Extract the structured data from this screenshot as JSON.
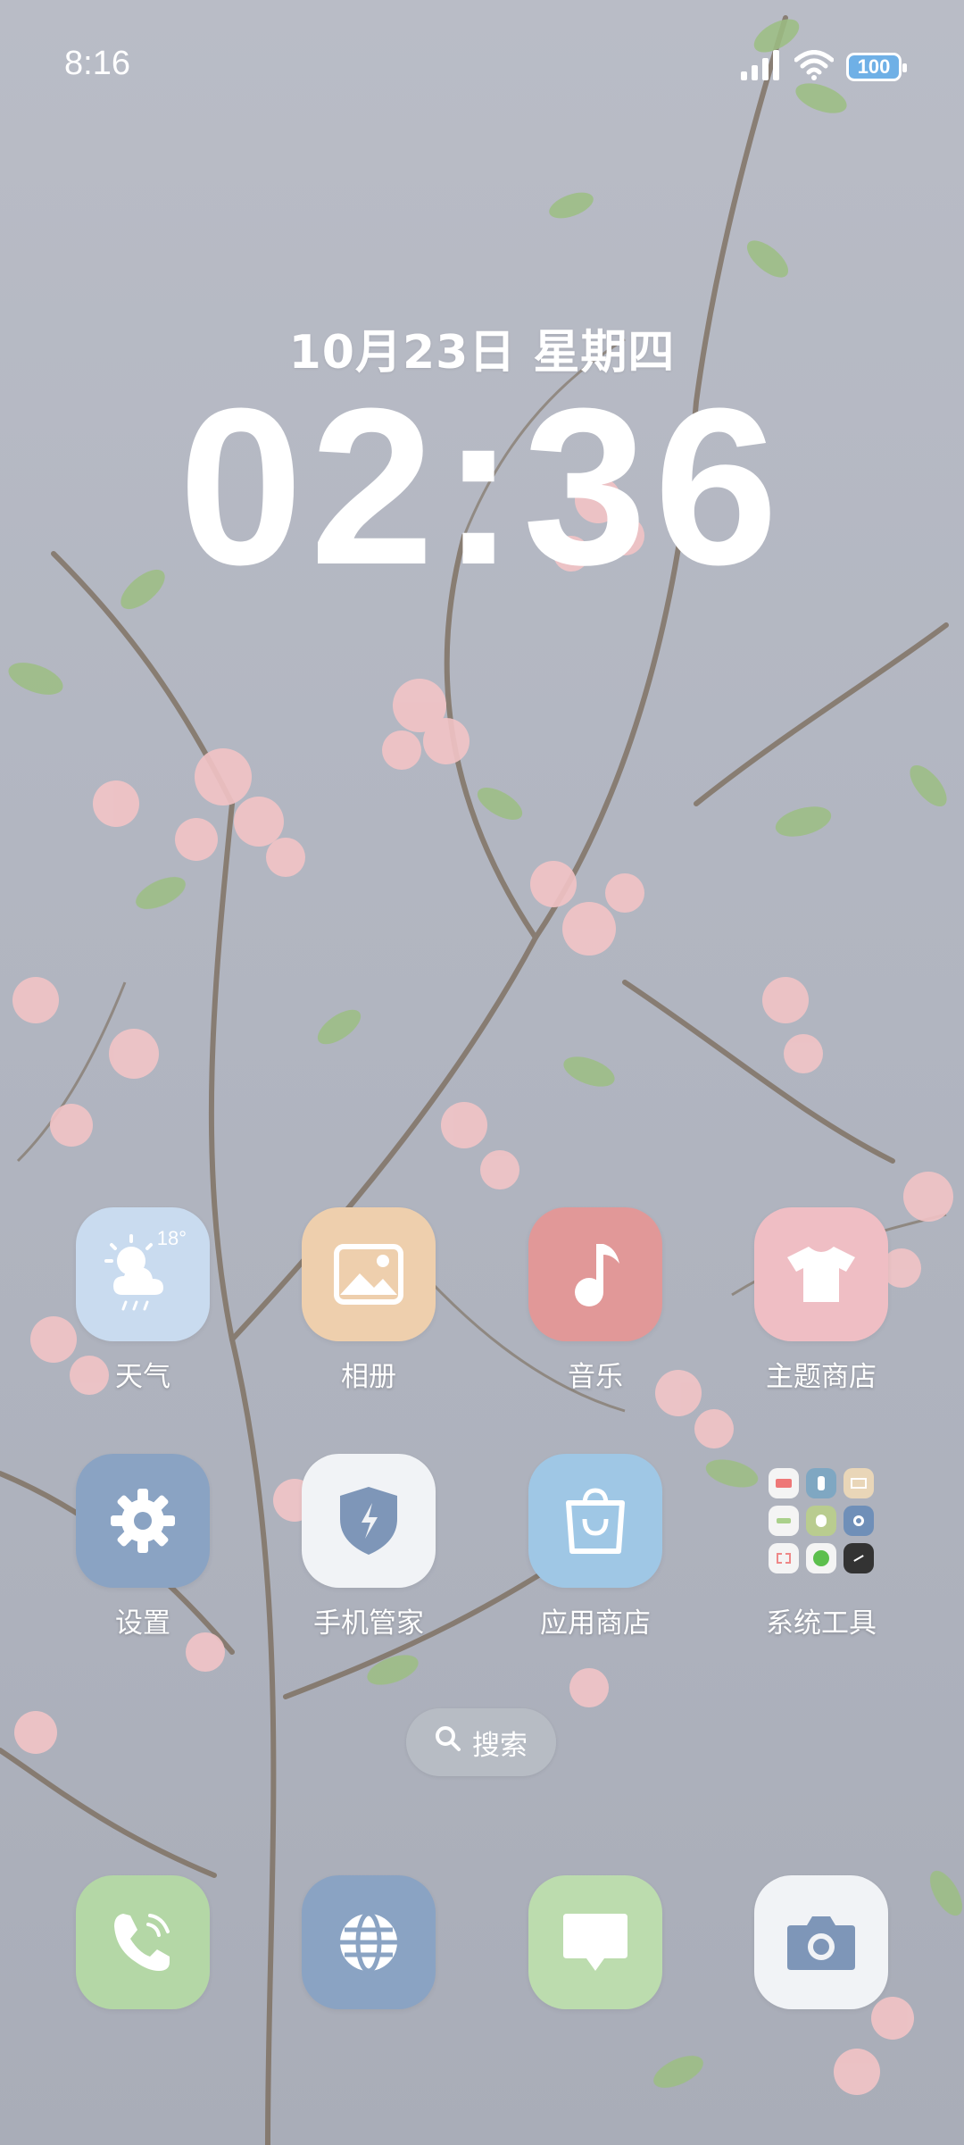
{
  "status_bar": {
    "time": "8:16",
    "battery": "100",
    "icons": [
      "signal-icon",
      "wifi-icon",
      "battery-icon"
    ]
  },
  "clock_widget": {
    "date": "10月23日 星期四",
    "time": "02:36"
  },
  "home_apps": [
    {
      "label": "天气",
      "icon": "weather-icon",
      "weather_temp": "18°",
      "color": "#c9dbef"
    },
    {
      "label": "相册",
      "icon": "gallery-icon",
      "color": "#eecfad"
    },
    {
      "label": "音乐",
      "icon": "music-note-icon",
      "color": "#e19898"
    },
    {
      "label": "主题商店",
      "icon": "tshirt-icon",
      "color": "#efbec4"
    },
    {
      "label": "设置",
      "icon": "gear-icon",
      "color": "#8aa3c3"
    },
    {
      "label": "手机管家",
      "icon": "shield-icon",
      "color": "#f1f3f6"
    },
    {
      "label": "应用商店",
      "icon": "shopping-bag-icon",
      "color": "#9fc7e5"
    },
    {
      "label": "系统工具",
      "icon": "folder-icon",
      "color": "transparent"
    }
  ],
  "search": {
    "label": "搜索",
    "icon": "search-icon"
  },
  "dock": [
    {
      "name": "phone",
      "icon": "phone-icon",
      "color": "#b4d7a6"
    },
    {
      "name": "browser",
      "icon": "globe-icon",
      "color": "#8aa3c3"
    },
    {
      "name": "messages",
      "icon": "message-icon",
      "color": "#bcdcae"
    },
    {
      "name": "camera",
      "icon": "camera-icon",
      "color": "#f1f3f6"
    }
  ],
  "colors": {
    "wallpaper_sky": "#b5b9c4",
    "blossom": "#f2c4c6",
    "leaf": "#9cbf82"
  }
}
